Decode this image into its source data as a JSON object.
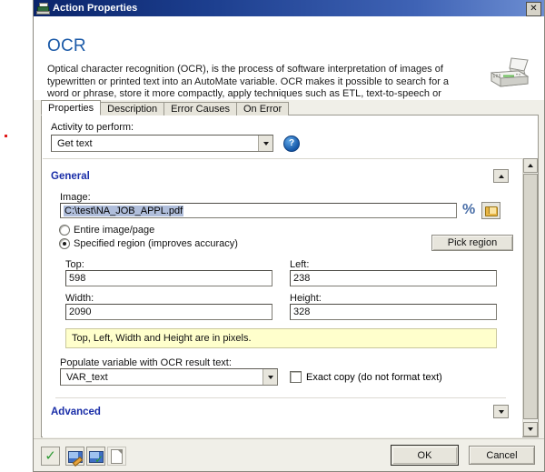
{
  "window": {
    "title": "Action Properties",
    "icon": "fax-machine-icon",
    "close_label": "✕"
  },
  "header": {
    "title": "OCR",
    "description": "Optical character recognition (OCR), is the process of software interpretation of images of typewritten or printed text into an AutoMate variable. OCR makes it possible to search for a word or phrase, store it more compactly, apply techniques such as ETL, text-to-speech or text mining.",
    "illustration": "fax-machine-icon"
  },
  "tabs": [
    {
      "label": "Properties",
      "active": true
    },
    {
      "label": "Description",
      "active": false
    },
    {
      "label": "Error Causes",
      "active": false
    },
    {
      "label": "On Error",
      "active": false
    }
  ],
  "activity": {
    "label": "Activity to perform:",
    "value": "Get text",
    "help_icon": "help-circle-icon",
    "help_glyph": "?"
  },
  "sections": {
    "general": {
      "label": "General",
      "expanded": true,
      "toggle_glyph": "▲"
    },
    "advanced": {
      "label": "Advanced",
      "expanded": false,
      "toggle_glyph": "▼"
    }
  },
  "image_field": {
    "label": "Image:",
    "value": "C:\\test\\NA_JOB_APPL.pdf",
    "selected": true,
    "percent_icon": "percent-variable-icon",
    "percent_glyph": "%",
    "browse_icon": "folder-browse-icon"
  },
  "region_mode": {
    "options": [
      {
        "label": "Entire image/page",
        "selected": false
      },
      {
        "label": "Specified region (improves accuracy)",
        "selected": true
      }
    ],
    "pick_region_label": "Pick region"
  },
  "coordinates": [
    {
      "label": "Top:",
      "value": "598"
    },
    {
      "label": "Left:",
      "value": "238"
    },
    {
      "label": "Width:",
      "value": "2090"
    },
    {
      "label": "Height:",
      "value": "328"
    }
  ],
  "note": "Top, Left, Width and Height are in pixels.",
  "populate": {
    "label": "Populate variable with OCR result text:",
    "value": "VAR_text"
  },
  "exact_copy": {
    "label": "Exact copy (do not format text)",
    "checked": false
  },
  "scrollbar": {
    "up_glyph": "▲",
    "down_glyph": "▼"
  },
  "toolbar": [
    {
      "name": "validate-button",
      "icon": "green-check-icon"
    },
    {
      "name": "edit-note-button",
      "icon": "note-pencil-icon"
    },
    {
      "name": "apply-note-button",
      "icon": "note-check-icon"
    },
    {
      "name": "new-page-button",
      "icon": "blank-page-icon"
    }
  ],
  "footer": {
    "ok_label": "OK",
    "cancel_label": "Cancel"
  },
  "colors": {
    "title_bar": "#0a246a",
    "section_heading": "#1a2ea8",
    "page_heading": "#1b5aa8",
    "note_background": "#ffffcc",
    "selection": "#b0bedb",
    "dialog_face": "#f0efe8"
  }
}
